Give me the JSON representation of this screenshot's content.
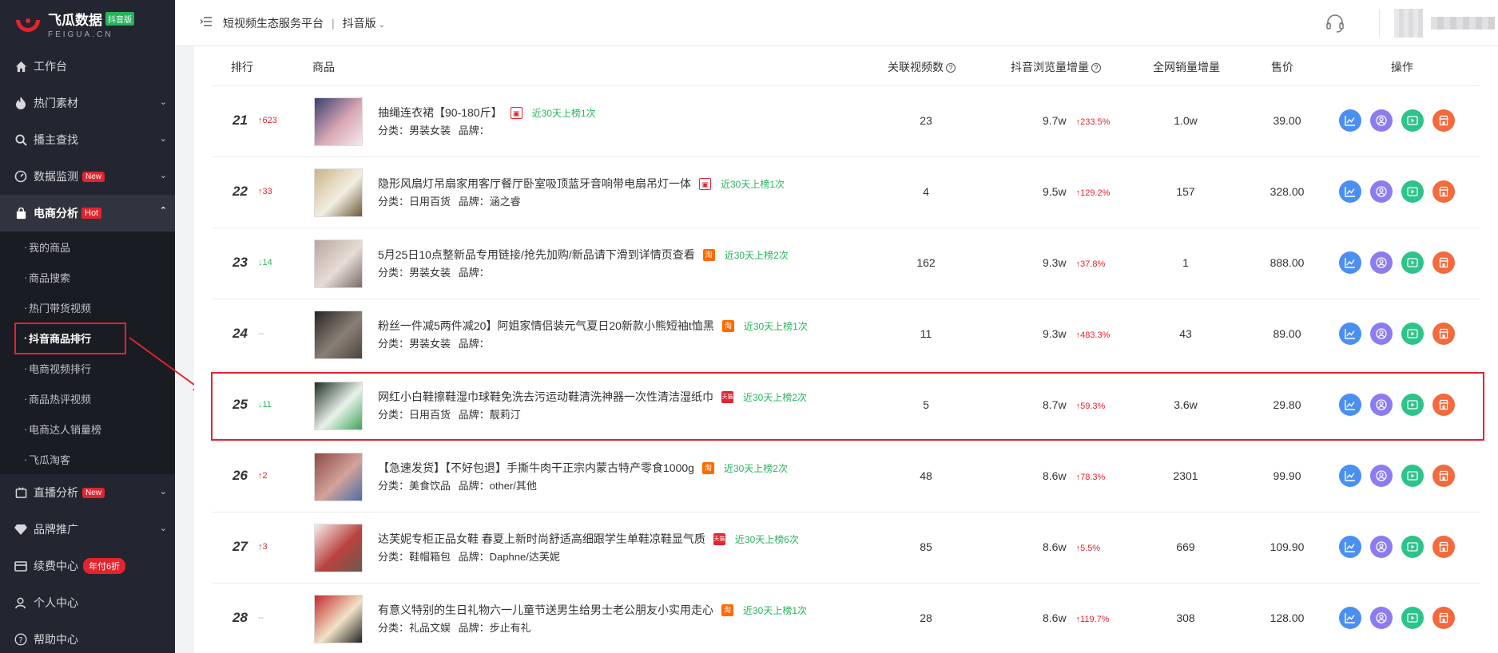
{
  "brand": {
    "name": "飞瓜数据",
    "badge": "抖音版",
    "sub": "FEIGUA.CN"
  },
  "header": {
    "crumb": "短视频生态服务平台",
    "separator": "|",
    "version": "抖音版"
  },
  "sidebar": {
    "items": [
      {
        "label": "工作台",
        "icon": "home-icon"
      },
      {
        "label": "热门素材",
        "icon": "flame-icon"
      },
      {
        "label": "播主查找",
        "icon": "search-icon"
      },
      {
        "label": "数据监测",
        "icon": "gauge-icon",
        "tag": "New"
      },
      {
        "label": "电商分析",
        "icon": "bag-icon",
        "tag": "Hot"
      }
    ],
    "sub_items": [
      "我的商品",
      "商品搜索",
      "热门带货视频",
      "抖音商品排行",
      "电商视频排行",
      "商品热评视频",
      "电商达人销量榜",
      "飞瓜淘客"
    ],
    "items_after": [
      {
        "label": "直播分析",
        "icon": "live-icon",
        "tag": "New"
      },
      {
        "label": "品牌推广",
        "icon": "diamond-icon"
      },
      {
        "label": "续费中心",
        "icon": "card-icon",
        "tag": "年付6折"
      },
      {
        "label": "个人中心",
        "icon": "user-icon"
      },
      {
        "label": "帮助中心",
        "icon": "help-icon"
      }
    ]
  },
  "table": {
    "headers": {
      "rank": "排行",
      "product": "商品",
      "videos": "关联视频数",
      "views": "抖音浏览量增量",
      "sales": "全网销量增量",
      "price": "售价",
      "ops": "操作"
    },
    "meta_labels": {
      "category": "分类：",
      "brand": "品牌："
    },
    "rows": [
      {
        "rank": "21",
        "change": "623",
        "dir": "up",
        "name": "抽绳连衣裙【90-180斤】",
        "store": "dy",
        "recent": "近30天上榜1次",
        "category": "男装女装",
        "brand": "",
        "videos": "23",
        "views": "9.7w",
        "views_pct": "233.5%",
        "sales": "1.0w",
        "price": "39.00",
        "thumb": [
          "#3a3f6e",
          "#d9a8b5",
          "#f4e9ec"
        ]
      },
      {
        "rank": "22",
        "change": "33",
        "dir": "up",
        "name": "隐形风扇灯吊扇家用客厅餐厅卧室吸顶蓝牙音响带电扇吊灯一体",
        "store": "dy",
        "recent": "近30天上榜1次",
        "category": "日用百货",
        "brand": "涵之睿",
        "videos": "4",
        "views": "9.5w",
        "views_pct": "129.2%",
        "sales": "157",
        "price": "328.00",
        "thumb": [
          "#c9b48a",
          "#f3eee2",
          "#6b5a3c"
        ]
      },
      {
        "rank": "23",
        "change": "14",
        "dir": "down",
        "name": "5月25日10点整新品专用链接/抢先加购/新品请下滑到详情页查看",
        "store": "tb",
        "recent": "近30天上榜2次",
        "category": "男装女装",
        "brand": "",
        "videos": "162",
        "views": "9.3w",
        "views_pct": "37.8%",
        "sales": "1",
        "price": "888.00",
        "thumb": [
          "#b9a7a0",
          "#e6dcd5",
          "#7a6a66"
        ]
      },
      {
        "rank": "24",
        "change": "--",
        "dir": "flat",
        "name": "粉丝一件减5两件减20】阿姐家情侣装元气夏日20新款小熊短袖t恤黑",
        "store": "tb",
        "recent": "近30天上榜1次",
        "category": "男装女装",
        "brand": "",
        "videos": "11",
        "views": "9.3w",
        "views_pct": "483.3%",
        "sales": "43",
        "price": "89.00",
        "thumb": [
          "#2a2624",
          "#8a7f76",
          "#4b443f"
        ]
      },
      {
        "rank": "25",
        "change": "11",
        "dir": "down",
        "name": "网红小白鞋擦鞋湿巾球鞋免洗去污运动鞋清洗神器一次性清洁湿纸巾",
        "store": "tm",
        "recent": "近30天上榜2次",
        "category": "日用百货",
        "brand": "靓莉汀",
        "videos": "5",
        "views": "8.7w",
        "views_pct": "59.3%",
        "sales": "3.6w",
        "price": "29.80",
        "thumb": [
          "#1d2e22",
          "#e9f3ea",
          "#3da35a"
        ]
      },
      {
        "rank": "26",
        "change": "2",
        "dir": "up",
        "name": "【急速发货】【不好包退】手撕牛肉干正宗内蒙古特产零食1000g",
        "store": "tb",
        "recent": "近30天上榜2次",
        "category": "美食饮品",
        "brand": "other/其他",
        "videos": "48",
        "views": "8.6w",
        "views_pct": "78.3%",
        "sales": "2301",
        "price": "99.90",
        "thumb": [
          "#8e4b46",
          "#d3a29a",
          "#4a6ea6"
        ]
      },
      {
        "rank": "27",
        "change": "3",
        "dir": "up",
        "name": "达芙妮专柜正品女鞋 春夏上新时尚舒适高细跟学生单鞋凉鞋显气质",
        "store": "tm",
        "recent": "近30天上榜6次",
        "category": "鞋帽箱包",
        "brand": "Daphne/达芙妮",
        "videos": "85",
        "views": "8.6w",
        "views_pct": "5.5%",
        "sales": "669",
        "price": "109.90",
        "thumb": [
          "#f6eeee",
          "#b9423d",
          "#6a5a4f"
        ]
      },
      {
        "rank": "28",
        "change": "--",
        "dir": "flat",
        "name": "有意义特别的生日礼物六一儿童节送男生给男士老公朋友小实用走心",
        "store": "tb",
        "recent": "近30天上榜1次",
        "category": "礼品文娱",
        "brand": "步止有礼",
        "videos": "28",
        "views": "8.6w",
        "views_pct": "119.7%",
        "sales": "308",
        "price": "128.00",
        "thumb": [
          "#c52b2b",
          "#f1e2c8",
          "#222"
        ]
      }
    ]
  },
  "colors": {
    "accent_red": "#e2242e",
    "green": "#27b35b",
    "sidebar_bg": "#232630",
    "action_blue": "#4b8ff0",
    "action_purple": "#8b7cf0",
    "action_green": "#2ec38a",
    "action_orange": "#f36a3d"
  },
  "actions": [
    "trend-icon",
    "blogger-icon",
    "video-icon",
    "shop-icon"
  ]
}
